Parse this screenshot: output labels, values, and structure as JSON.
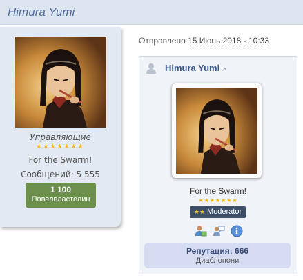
{
  "topic_header": {
    "author_name": "Himura Yumi"
  },
  "author_panel": {
    "group": "Управляющие",
    "motto": "For the Swarm!",
    "posts_label": "Сообщений:",
    "posts_count": "5 555",
    "reputation_value": "1 100",
    "reputation_title": "Повелвластелин",
    "group_star_count": 7
  },
  "post": {
    "posted_label": "Отправлено",
    "posted_date": "15 Июнь 2018 - 10:33",
    "author_name": "Himura Yumi",
    "motto": "For the Swarm!",
    "star_count": 7,
    "moderator_label": "Moderator",
    "reputation_label": "Репутация: 666",
    "reputation_title": "Диаблопони",
    "icons": [
      "user-card-icon",
      "messages-icon",
      "info-icon"
    ]
  },
  "colors": {
    "header_bg": "#dde5f0",
    "name_color": "#4f6c9a",
    "rep_badge_green": "#6c8f4b",
    "moderator_badge": "#3b4f69",
    "star_gold": "#f0b400",
    "rep_box_bg": "#d5dbf0"
  }
}
